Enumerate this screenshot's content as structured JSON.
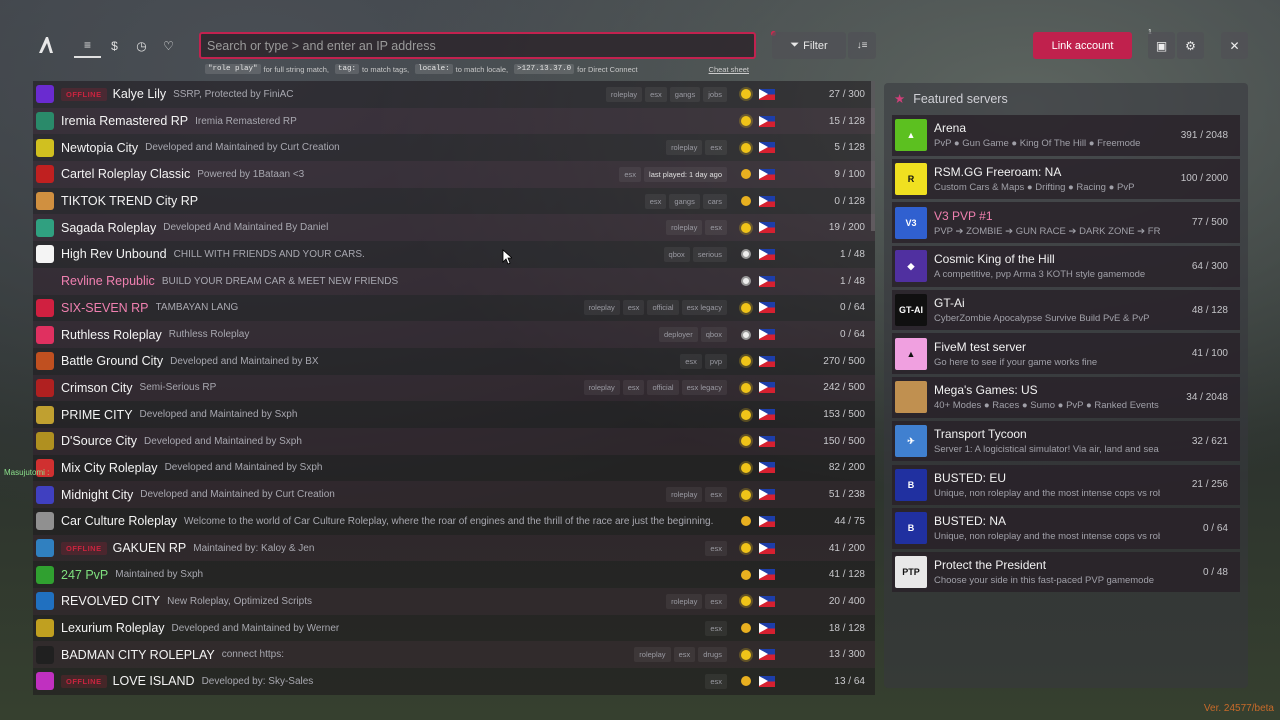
{
  "search": {
    "placeholder": "Search or type > and enter an IP address"
  },
  "hints": [
    {
      "code": "\"role play\"",
      "text": "for full string match,"
    },
    {
      "code": "tag:",
      "text": "to match tags,"
    },
    {
      "code": "locale:",
      "text": "to match locale,"
    },
    {
      "code": ">127.13.37.0",
      "text": "for Direct Connect"
    }
  ],
  "cheat_sheet": "Cheat sheet",
  "toolbar": {
    "filter_label": "Filter",
    "link_label": "Link account",
    "notif_count": "1"
  },
  "offline_label": "OFFLINE",
  "servers": [
    {
      "name": "Kalye Lily",
      "desc": "SSRP, Protected by FiniAC",
      "tags": [
        "roleplay",
        "esx",
        "gangs",
        "jobs"
      ],
      "players": "27 / 300",
      "offline": true,
      "icon": "#6a2bd0",
      "status": "sun"
    },
    {
      "name": "Iremia Remastered RP",
      "desc": "Iremia Remastered RP",
      "tags": [],
      "players": "15 / 128",
      "icon": "#2a8a6a",
      "status": "sun"
    },
    {
      "name": "Newtopia City",
      "desc": "Developed and Maintained by Curt Creation",
      "tags": [
        "roleplay",
        "esx"
      ],
      "players": "5 / 128",
      "icon": "#d0c020",
      "status": "sun"
    },
    {
      "name": "Cartel Roleplay Classic",
      "desc": "Powered by 1Bataan <3",
      "tags": [
        "esx"
      ],
      "lastplayed": "last played: 1 day ago",
      "players": "9 / 100",
      "icon": "#c02020",
      "status": "moon"
    },
    {
      "name": "TIKTOK TREND City RP",
      "desc": "",
      "tags": [
        "esx",
        "gangs",
        "cars"
      ],
      "players": "0 / 128",
      "icon": "#d09040",
      "status": "moon"
    },
    {
      "name": "Sagada Roleplay",
      "desc": "Developed And Maintained By Daniel",
      "tags": [
        "roleplay",
        "esx"
      ],
      "players": "19 / 200",
      "icon": "#30a080",
      "status": "sun"
    },
    {
      "name": "High Rev Unbound",
      "desc": "CHILL WITH FRIENDS AND YOUR CARS.",
      "tags": [
        "qbox",
        "serious"
      ],
      "players": "1 / 48",
      "icon": "#f4f4f4",
      "status": "white"
    },
    {
      "name": "Revline Republic",
      "desc": "BUILD YOUR DREAM CAR & MEET NEW FRIENDS",
      "tags": [],
      "players": "1 / 48",
      "pink": true,
      "icon": "transparent",
      "status": "white"
    },
    {
      "name": "SIX-SEVEN RP",
      "desc": "TAMBAYAN LANG",
      "tags": [
        "roleplay",
        "esx",
        "official",
        "esx legacy"
      ],
      "players": "0 / 64",
      "pink": true,
      "icon": "#d02040",
      "status": "sun"
    },
    {
      "name": "Ruthless Roleplay",
      "desc": "Ruthless Roleplay",
      "tags": [
        "deployer",
        "qbox"
      ],
      "players": "0 / 64",
      "icon": "#e03060",
      "status": "white"
    },
    {
      "name": "Battle Ground City",
      "desc": "Developed and Maintained by BX",
      "tags": [
        "esx",
        "pvp"
      ],
      "players": "270 / 500",
      "icon": "#c05020",
      "status": "sun"
    },
    {
      "name": "Crimson City",
      "desc": "Semi-Serious RP",
      "tags": [
        "roleplay",
        "esx",
        "official",
        "esx legacy"
      ],
      "players": "242 / 500",
      "icon": "#b02020",
      "status": "sun"
    },
    {
      "name": "PRIME CITY",
      "desc": "Developed and Maintained by Sxph",
      "tags": [],
      "players": "153 / 500",
      "icon": "#c0a030",
      "status": "sun"
    },
    {
      "name": "D'Source City",
      "desc": "Developed and Maintained by Sxph",
      "tags": [],
      "players": "150 / 500",
      "icon": "#b09020",
      "status": "sun"
    },
    {
      "name": "Mix City Roleplay",
      "desc": "Developed and Maintained by Sxph",
      "tags": [],
      "players": "82 / 200",
      "icon": "#d03030",
      "status": "sun"
    },
    {
      "name": "Midnight City",
      "desc": "Developed and Maintained by Curt Creation",
      "tags": [
        "roleplay",
        "esx"
      ],
      "players": "51 / 238",
      "icon": "#4040c0",
      "status": "sun"
    },
    {
      "name": "Car Culture Roleplay",
      "desc": "Welcome to the world of Car Culture Roleplay, where the roar of engines and the thrill of the race are just the beginning.",
      "tags": [],
      "players": "44 / 75",
      "icon": "#909090",
      "status": "moon"
    },
    {
      "name": "GAKUEN RP",
      "desc": "Maintained by: Kaloy & Jen",
      "tags": [
        "esx"
      ],
      "players": "41 / 200",
      "offline": true,
      "icon": "#3080c0",
      "status": "sun"
    },
    {
      "name": "247 PvP",
      "desc": "Maintained by Sxph",
      "tags": [],
      "players": "41 / 128",
      "green": true,
      "icon": "#30a030",
      "status": "moon"
    },
    {
      "name": "REVOLVED CITY",
      "desc": "New Roleplay, Optimized Scripts",
      "tags": [
        "roleplay",
        "esx"
      ],
      "players": "20 / 400",
      "icon": "#2070c0",
      "status": "sun"
    },
    {
      "name": "Lexurium Roleplay",
      "desc": "Developed and Maintained by Werner",
      "tags": [
        "esx"
      ],
      "players": "18 / 128",
      "icon": "#c0a020",
      "status": "moon"
    },
    {
      "name": "BADMAN CITY ROLEPLAY",
      "desc": "connect https:",
      "tags": [
        "roleplay",
        "esx",
        "drugs"
      ],
      "players": "13 / 300",
      "icon": "#202020",
      "status": "sun"
    },
    {
      "name": "LOVE ISLAND",
      "desc": "Developed by: Sky-Sales",
      "tags": [
        "esx"
      ],
      "players": "13 / 64",
      "offline": true,
      "icon": "#c030c0",
      "status": "moon"
    }
  ],
  "featured": {
    "title": "Featured servers",
    "items": [
      {
        "name": "Arena",
        "desc": "PvP ● Gun Game ● King Of The Hill ● Freemode",
        "players": "391 / 2048",
        "icon": "#5cc020",
        "glyph": "▲"
      },
      {
        "name": "RSM.GG Freeroam: NA",
        "desc": "Custom Cars & Maps ● Drifting ● Racing ● PvP",
        "players": "100 / 2000",
        "icon": "#f0e020",
        "glyph": "R"
      },
      {
        "name": "V3 PVP #1",
        "desc": "PVP ➔ ZOMBIE ➔ GUN RACE ➔ DARK ZONE ➔ FREE",
        "players": "77 / 500",
        "pink": true,
        "icon": "#3060d0",
        "glyph": "V3"
      },
      {
        "name": "Cosmic King of the Hill",
        "desc": "A competitive, pvp Arma 3 KOTH style gamemode",
        "players": "64 / 300",
        "icon": "#5030a0",
        "glyph": "◆"
      },
      {
        "name": "GT-Ai",
        "desc": "CyberZombie Apocalypse Survive Build PvE & PvP",
        "players": "48 / 128",
        "icon": "#101010",
        "glyph": "GT-AI"
      },
      {
        "name": "FiveM test server",
        "desc": "Go here to see if your game works fine",
        "players": "41 / 100",
        "icon": "#f0a0e0",
        "glyph": "▲"
      },
      {
        "name": "Mega's Games: US",
        "desc": "40+ Modes ● Races ● Sumo ● PvP ● Ranked Events",
        "players": "34 / 2048",
        "icon": "#c09050",
        "glyph": ""
      },
      {
        "name": "Transport Tycoon",
        "desc": "Server 1: A logicistical simulator! Via air, land and sea",
        "players": "32 / 621",
        "icon": "#4080d0",
        "glyph": "✈"
      },
      {
        "name": "BUSTED: EU",
        "desc": "Unique, non roleplay and the most intense cops vs robbers",
        "players": "21 / 256",
        "icon": "#2030a0",
        "glyph": "B"
      },
      {
        "name": "BUSTED: NA",
        "desc": "Unique, non roleplay and the most intense cops vs robbers",
        "players": "0 / 64",
        "icon": "#2030a0",
        "glyph": "B"
      },
      {
        "name": "Protect the President",
        "desc": "Choose your side in this fast-paced PVP gamemode",
        "players": "0 / 48",
        "icon": "#e8e8e8",
        "glyph": "PTP"
      }
    ]
  },
  "chat_user": "Masujutomi :",
  "version": "Ver. 24577/beta"
}
